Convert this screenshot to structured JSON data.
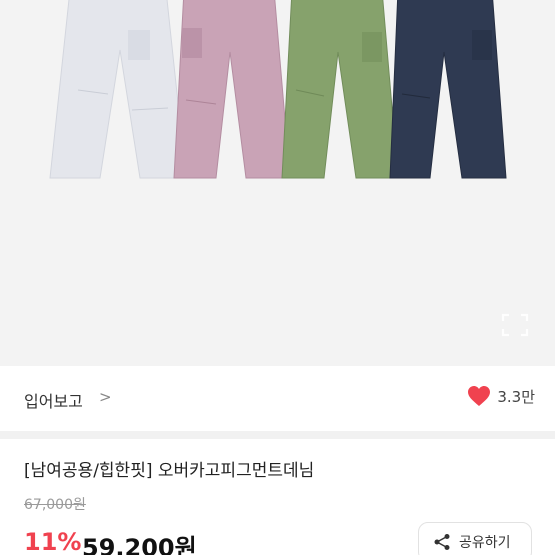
{
  "product_image": {
    "variants": [
      {
        "icon": "pants-light-gray",
        "color": "#e4e6ec"
      },
      {
        "icon": "pants-pink",
        "color": "#c9a3b6"
      },
      {
        "icon": "pants-green",
        "color": "#86a26c"
      },
      {
        "icon": "pants-navy",
        "color": "#2f3a52"
      }
    ]
  },
  "seller": {
    "name": "입어보고",
    "chevron": ">"
  },
  "likes": {
    "count": "3.3만",
    "heart_color": "#f0424f"
  },
  "product": {
    "title": "[남여공용/힙한핏] 오버카고피그먼트데님",
    "original_price": "67,000원",
    "discount": "11%",
    "sale_price": "59,200원"
  },
  "share": {
    "label": "공유하기"
  }
}
